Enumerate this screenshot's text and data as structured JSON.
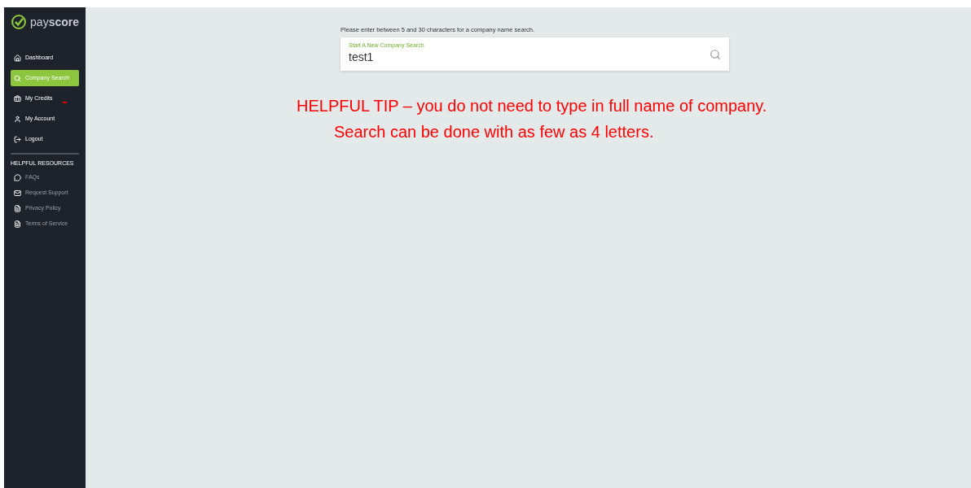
{
  "sidebar": {
    "logo": "pay**score**",
    "nav": [
      {
        "label": "Dashboard",
        "selected": false
      },
      {
        "label": "Company Search",
        "selected": true
      },
      {
        "label": "My Credits",
        "selected": false
      },
      {
        "label": "My Account",
        "selected": false
      },
      {
        "label": "Logout",
        "selected": false
      }
    ],
    "resources_heading": "HELPFUL RESOURCES",
    "resources": [
      {
        "label": "FAQs"
      },
      {
        "label": "Request Support"
      },
      {
        "label": "Privacy Policy"
      },
      {
        "label": "Terms of Service"
      }
    ]
  },
  "search": {
    "hint": "Please enter between 5 and 30 characters for a company name search.",
    "floating_label": "Start A New Company Search",
    "value": "test1"
  },
  "tip": {
    "lines": [
      "HELPFUL TIP – you do not need to type in full name of company.",
      "Search can be done with as few as 4 letters."
    ]
  }
}
